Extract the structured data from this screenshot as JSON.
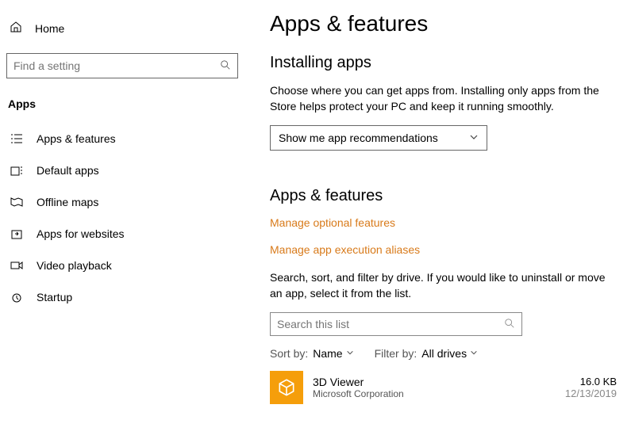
{
  "sidebar": {
    "home_label": "Home",
    "search_placeholder": "Find a setting",
    "section_title": "Apps",
    "items": [
      {
        "label": "Apps & features"
      },
      {
        "label": "Default apps"
      },
      {
        "label": "Offline maps"
      },
      {
        "label": "Apps for websites"
      },
      {
        "label": "Video playback"
      },
      {
        "label": "Startup"
      }
    ]
  },
  "main": {
    "title": "Apps & features",
    "installing_header": "Installing apps",
    "installing_desc": "Choose where you can get apps from. Installing only apps from the Store helps protect your PC and keep it running smoothly.",
    "dropdown_value": "Show me app recommendations",
    "af_header": "Apps & features",
    "link_optional": "Manage optional features",
    "link_alias": "Manage app execution aliases",
    "instructions": "Search, sort, and filter by drive. If you would like to uninstall or move an app, select it from the list.",
    "search_placeholder": "Search this list",
    "sort_label": "Sort by:",
    "sort_value": "Name",
    "filter_label": "Filter by:",
    "filter_value": "All drives",
    "app": {
      "name": "3D Viewer",
      "publisher": "Microsoft Corporation",
      "size": "16.0 KB",
      "date": "12/13/2019"
    }
  }
}
